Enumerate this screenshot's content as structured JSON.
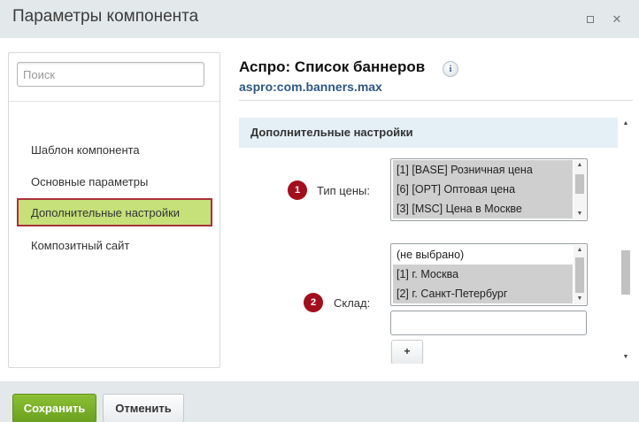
{
  "window": {
    "title": "Параметры компонента",
    "maximize_icon": "maximize-icon",
    "close_icon": "close-icon",
    "close_glyph": "✕"
  },
  "sidebar": {
    "search_placeholder": "Поиск",
    "items": [
      {
        "label": "Шаблон компонента",
        "active": false
      },
      {
        "label": "Основные параметры",
        "active": false
      },
      {
        "label": "Дополнительные настройки",
        "active": true
      },
      {
        "label": "Композитный сайт",
        "active": false
      }
    ],
    "active_item_background": "#c6e07a",
    "active_item_border": "#a8323a"
  },
  "main": {
    "title": "Аспро: Список баннеров",
    "info_glyph": "i",
    "subtitle": "aspro:com.banners.max",
    "subtitle_color": "#2f5883",
    "section_title": "Дополнительные настройки",
    "fields": {
      "price_type": {
        "badge": "1",
        "label": "Тип цены:",
        "options": [
          {
            "text": "[1] [BASE] Розничная цена",
            "selected": true
          },
          {
            "text": "[6] [OPT] Оптовая цена",
            "selected": true
          },
          {
            "text": "[3] [MSC] Цена в Москве",
            "selected": true
          }
        ]
      },
      "warehouse": {
        "badge": "2",
        "label": "Склад:",
        "options": [
          {
            "text": "(не выбрано)",
            "selected": false
          },
          {
            "text": "[1] г. Москва",
            "selected": true
          },
          {
            "text": "[2] г. Санкт-Петербург",
            "selected": true
          }
        ],
        "text_value": "",
        "add_button_label": "+"
      }
    },
    "badge_color": "#a40e1c"
  },
  "footer": {
    "save_label": "Сохранить",
    "cancel_label": "Отменить",
    "save_color": "#7bb12a"
  }
}
